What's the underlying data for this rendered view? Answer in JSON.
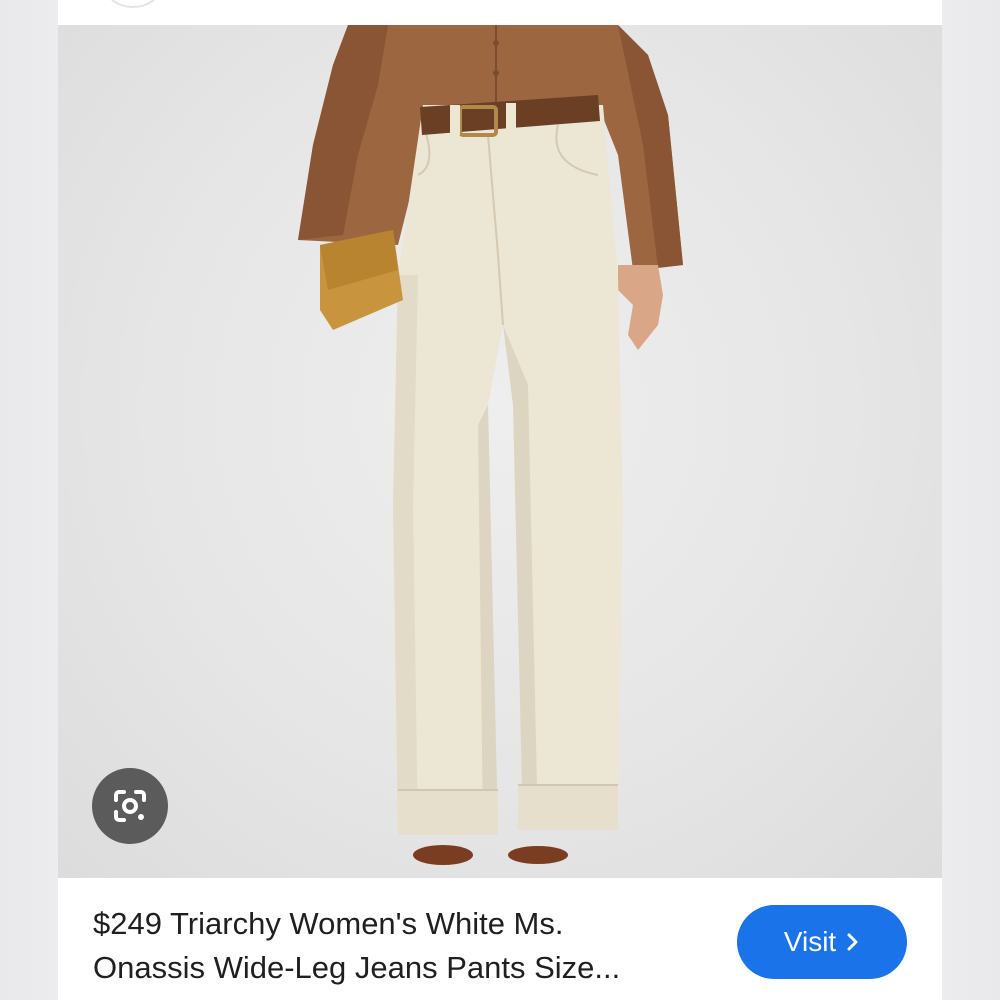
{
  "product": {
    "caption_line1": "$249 Triarchy Women's White Ms.",
    "caption_line2": "Onassis Wide-Leg Jeans Pants Size..."
  },
  "actions": {
    "visit_label": "Visit"
  },
  "icons": {
    "lens": "google-lens-icon",
    "visit_chevron": "chevron-right-icon"
  },
  "colors": {
    "visit_button": "#1a73e8",
    "lens_button": "#5b5b5b",
    "pants": "#ece6d4",
    "shirt": "#9c6640",
    "belt": "#6a3f24",
    "clutch": "#c8953e"
  }
}
